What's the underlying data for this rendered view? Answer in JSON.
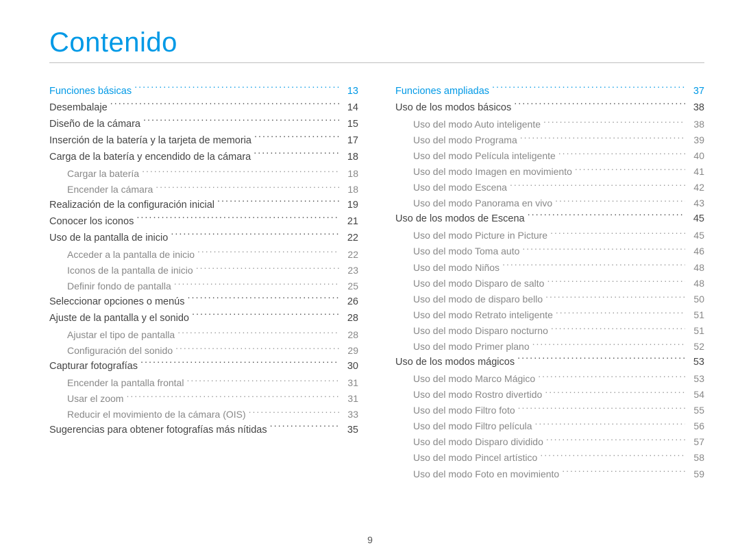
{
  "title": "Contenido",
  "page_number": "9",
  "columns": [
    [
      {
        "level": "section",
        "label": "Funciones básicas",
        "page": "13"
      },
      {
        "level": "sub",
        "label": "Desembalaje",
        "page": "14"
      },
      {
        "level": "sub",
        "label": "Diseño de la cámara",
        "page": "15"
      },
      {
        "level": "sub",
        "label": "Inserción de la batería y la tarjeta de memoria",
        "page": "17"
      },
      {
        "level": "sub",
        "label": "Carga de la batería y encendido de la cámara",
        "page": "18"
      },
      {
        "level": "subsub",
        "label": "Cargar la batería",
        "page": "18"
      },
      {
        "level": "subsub",
        "label": "Encender la cámara",
        "page": "18"
      },
      {
        "level": "sub",
        "label": "Realización de la configuración inicial",
        "page": "19"
      },
      {
        "level": "sub",
        "label": "Conocer los iconos",
        "page": "21"
      },
      {
        "level": "sub",
        "label": "Uso de la pantalla de inicio",
        "page": "22"
      },
      {
        "level": "subsub",
        "label": "Acceder a la pantalla de inicio",
        "page": "22"
      },
      {
        "level": "subsub",
        "label": "Iconos de la pantalla de inicio",
        "page": "23"
      },
      {
        "level": "subsub",
        "label": "Definir fondo de pantalla",
        "page": "25"
      },
      {
        "level": "sub",
        "label": "Seleccionar opciones o menús",
        "page": "26"
      },
      {
        "level": "sub",
        "label": "Ajuste de la pantalla y el sonido",
        "page": "28"
      },
      {
        "level": "subsub",
        "label": "Ajustar el tipo de pantalla",
        "page": "28"
      },
      {
        "level": "subsub",
        "label": "Configuración del sonido",
        "page": "29"
      },
      {
        "level": "sub",
        "label": "Capturar fotografías",
        "page": "30"
      },
      {
        "level": "subsub",
        "label": "Encender la pantalla frontal",
        "page": "31"
      },
      {
        "level": "subsub",
        "label": "Usar el zoom",
        "page": "31"
      },
      {
        "level": "subsub",
        "label": "Reducir el movimiento de la cámara (OIS)",
        "page": "33"
      },
      {
        "level": "sub",
        "label": "Sugerencias para obtener fotografías más nítidas",
        "page": "35"
      }
    ],
    [
      {
        "level": "section",
        "label": "Funciones ampliadas",
        "page": "37"
      },
      {
        "level": "sub",
        "label": "Uso de los modos básicos",
        "page": "38"
      },
      {
        "level": "subsub",
        "label": "Uso del modo Auto inteligente",
        "page": "38"
      },
      {
        "level": "subsub",
        "label": "Uso del modo Programa",
        "page": "39"
      },
      {
        "level": "subsub",
        "label": "Uso del modo Película inteligente",
        "page": "40"
      },
      {
        "level": "subsub",
        "label": "Uso del modo Imagen en movimiento",
        "page": "41"
      },
      {
        "level": "subsub",
        "label": "Uso del modo Escena",
        "page": "42"
      },
      {
        "level": "subsub",
        "label": "Uso del modo Panorama en vivo",
        "page": "43"
      },
      {
        "level": "sub",
        "label": "Uso de los modos de Escena",
        "page": "45"
      },
      {
        "level": "subsub",
        "label": "Uso del modo Picture in Picture",
        "page": "45"
      },
      {
        "level": "subsub",
        "label": "Uso del modo Toma auto",
        "page": "46"
      },
      {
        "level": "subsub",
        "label": "Uso del modo Niños",
        "page": "48"
      },
      {
        "level": "subsub",
        "label": "Uso del modo Disparo de salto",
        "page": "48"
      },
      {
        "level": "subsub",
        "label": "Uso del modo de disparo bello",
        "page": "50"
      },
      {
        "level": "subsub",
        "label": "Uso del modo Retrato inteligente",
        "page": "51"
      },
      {
        "level": "subsub",
        "label": "Uso del modo Disparo nocturno",
        "page": "51"
      },
      {
        "level": "subsub",
        "label": "Uso del modo Primer plano",
        "page": "52"
      },
      {
        "level": "sub",
        "label": "Uso de los modos mágicos",
        "page": "53"
      },
      {
        "level": "subsub",
        "label": "Uso del modo Marco Mágico",
        "page": "53"
      },
      {
        "level": "subsub",
        "label": "Uso del modo Rostro divertido",
        "page": "54"
      },
      {
        "level": "subsub",
        "label": "Uso del modo Filtro foto",
        "page": "55"
      },
      {
        "level": "subsub",
        "label": "Uso del modo Filtro película",
        "page": "56"
      },
      {
        "level": "subsub",
        "label": "Uso del modo Disparo dividido",
        "page": "57"
      },
      {
        "level": "subsub",
        "label": "Uso del modo Pincel artístico",
        "page": "58"
      },
      {
        "level": "subsub",
        "label": "Uso del modo Foto en movimiento",
        "page": "59"
      }
    ]
  ]
}
